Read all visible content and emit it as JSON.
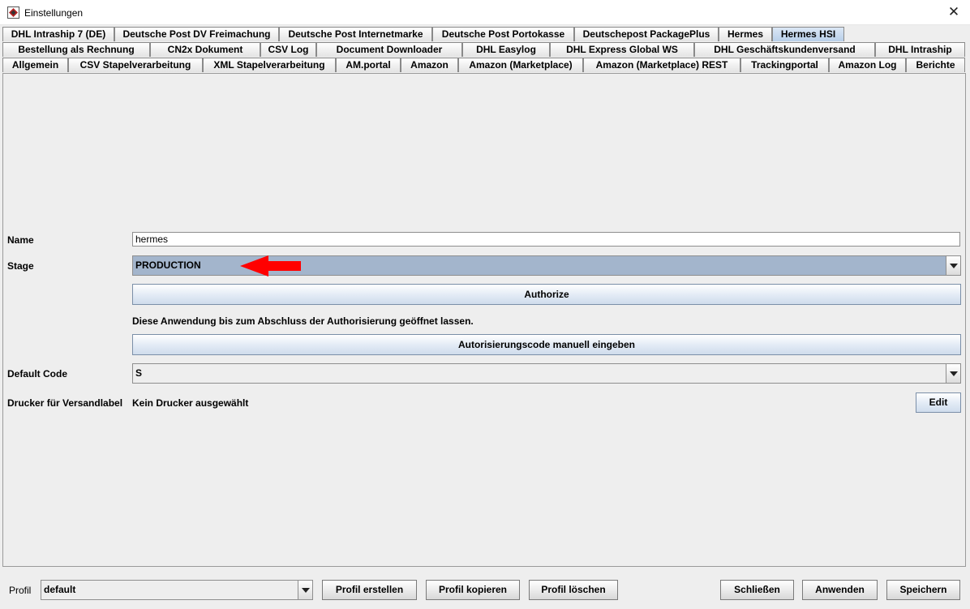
{
  "window": {
    "title": "Einstellungen",
    "close_symbol": "✕"
  },
  "tabs": {
    "row1": [
      "DHL Intraship 7 (DE)",
      "Deutsche Post DV Freimachung",
      "Deutsche Post Internetmarke",
      "Deutsche Post Portokasse",
      "Deutschepost PackagePlus",
      "Hermes",
      "Hermes HSI"
    ],
    "row2": [
      "Bestellung als Rechnung",
      "CN2x Dokument",
      "CSV Log",
      "Document Downloader",
      "DHL Easylog",
      "DHL Express Global WS",
      "DHL Geschäftskundenversand",
      "DHL Intraship"
    ],
    "row3": [
      "Allgemein",
      "CSV Stapelverarbeitung",
      "XML Stapelverarbeitung",
      "AM.portal",
      "Amazon",
      "Amazon (Marketplace)",
      "Amazon (Marketplace) REST",
      "Trackingportal",
      "Amazon Log",
      "Berichte"
    ],
    "selected": "Hermes HSI"
  },
  "form": {
    "name_label": "Name",
    "name_value": "hermes",
    "stage_label": "Stage",
    "stage_value": "PRODUCTION",
    "authorize_button": "Authorize",
    "info_text": "Diese Anwendung bis zum Abschluss der Authorisierung geöffnet lassen.",
    "manual_code_button": "Autorisierungscode manuell eingeben",
    "default_code_label": "Default Code",
    "default_code_value": "S",
    "printer_label": "Drucker für Versandlabel",
    "printer_value": "Kein Drucker ausgewählt",
    "edit_button": "Edit"
  },
  "footer": {
    "profile_label": "Profil",
    "profile_value": "default",
    "create_button": "Profil erstellen",
    "copy_button": "Profil kopieren",
    "delete_button": "Profil löschen",
    "close_button": "Schließen",
    "apply_button": "Anwenden",
    "save_button": "Speichern"
  },
  "colors": {
    "selected_tab": "#b8cfe9",
    "stage_combo_bg": "#a3b5cc",
    "annotation_arrow": "#ff0000"
  },
  "icons": {
    "window_icon": "app-window-icon",
    "dropdown": "chevron-down-icon",
    "arrow": "red-arrow-annotation"
  }
}
